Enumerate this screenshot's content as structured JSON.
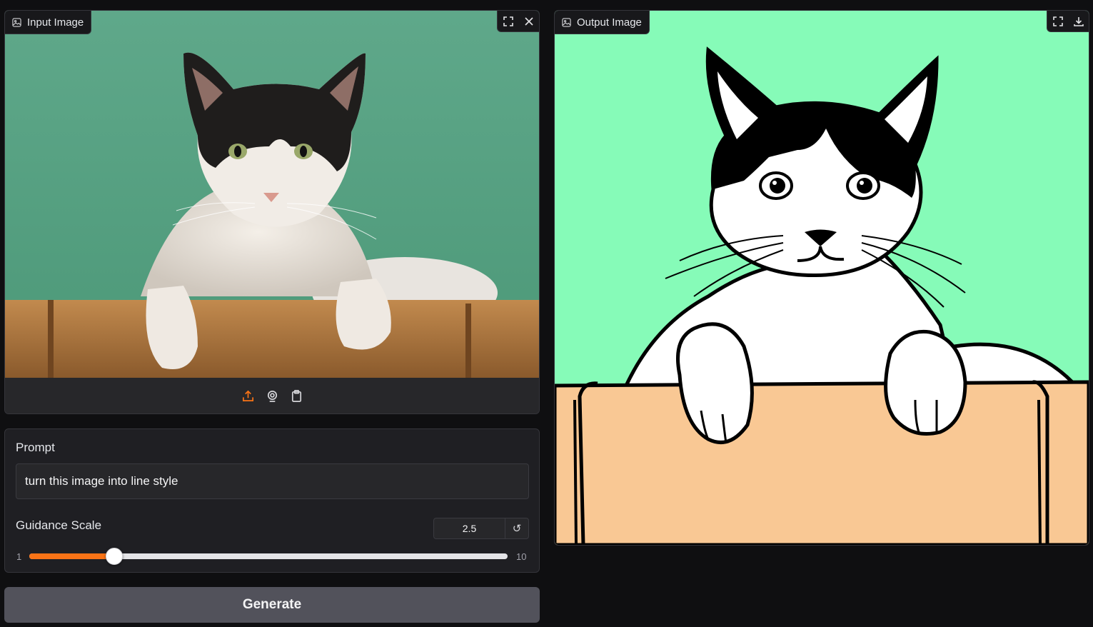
{
  "input_panel": {
    "label": "Input Image",
    "label_icon": "image-icon",
    "fullscreen_icon": "fullscreen-icon",
    "clear_icon": "close-icon",
    "tools": [
      "upload-icon",
      "webcam-icon",
      "clipboard-icon"
    ],
    "accent_color": "#f97316"
  },
  "output_panel": {
    "label": "Output Image",
    "label_icon": "image-icon",
    "fullscreen_icon": "fullscreen-icon",
    "download_icon": "download-icon"
  },
  "prompt": {
    "label": "Prompt",
    "value": "turn this image into line style"
  },
  "guidance": {
    "label": "Guidance Scale",
    "value": "2.5",
    "min": "1",
    "max": "10",
    "reset_icon": "reset-icon"
  },
  "generate": {
    "label": "Generate"
  },
  "colors": {
    "background": "#0f0f11",
    "panel": "#1f1f23",
    "slider_fill": "#f97316",
    "button": "#52525b"
  }
}
